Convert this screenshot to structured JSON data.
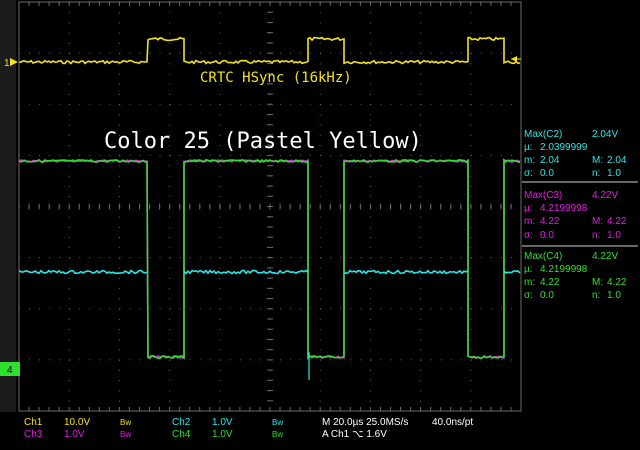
{
  "colors": {
    "bg": "#000000",
    "grid": "#6a6a6a",
    "ch1": "#f4e21a",
    "ch2": "#2be6e6",
    "ch3": "#e020e0",
    "ch4": "#2fe02f",
    "text": "#ffffff"
  },
  "screen": {
    "annotation_hsync": "CRTC HSync (16kHz)",
    "annotation_color": "Color 25 (Pastel Yellow)",
    "ch1_marker": "1",
    "ch4_marker": "4",
    "trigger_marker_icon": "left-arrow-icon"
  },
  "measurements": [
    {
      "source": "Max(C2)",
      "value": "2.04V",
      "mu_label": "µ:",
      "mu": "2.0399999",
      "m_label": "m:",
      "m": "2.04",
      "M_label": "M:",
      "M": "2.04",
      "sigma_label": "σ:",
      "sigma": "0.0",
      "n_label": "n:",
      "n": "1.0",
      "color": "#2be6e6"
    },
    {
      "source": "Max(C3)",
      "value": "4.22V",
      "mu_label": "µ:",
      "mu": "4.2199998",
      "m_label": "m:",
      "m": "4.22",
      "M_label": "M:",
      "M": "4.22",
      "sigma_label": "σ:",
      "sigma": "0.0",
      "n_label": "n:",
      "n": "1.0",
      "color": "#e020e0"
    },
    {
      "source": "Max(C4)",
      "value": "4.22V",
      "mu_label": "µ:",
      "mu": "4.2199998",
      "m_label": "m:",
      "m": "4.22",
      "M_label": "M:",
      "M": "4.22",
      "sigma_label": "σ:",
      "sigma": "0.0",
      "n_label": "n:",
      "n": "1.0",
      "color": "#2fe02f"
    }
  ],
  "status": {
    "ch1_label": "Ch1",
    "ch1_scale": "10.0V",
    "ch1_bw": "Bw",
    "ch2_label": "Ch2",
    "ch2_scale": "1.0V",
    "ch2_bw": "Bw",
    "ch3_label": "Ch3",
    "ch3_scale": "1.0V",
    "ch3_bw": "Bw",
    "ch4_label": "Ch4",
    "ch4_scale": "1.0V",
    "ch4_bw": "Bw",
    "timebase": "M 20.0µs 25.0MS/s",
    "sample_interval": "40.0ns/pt",
    "trigger": "A  Ch1  ⌥  1.6V"
  }
}
